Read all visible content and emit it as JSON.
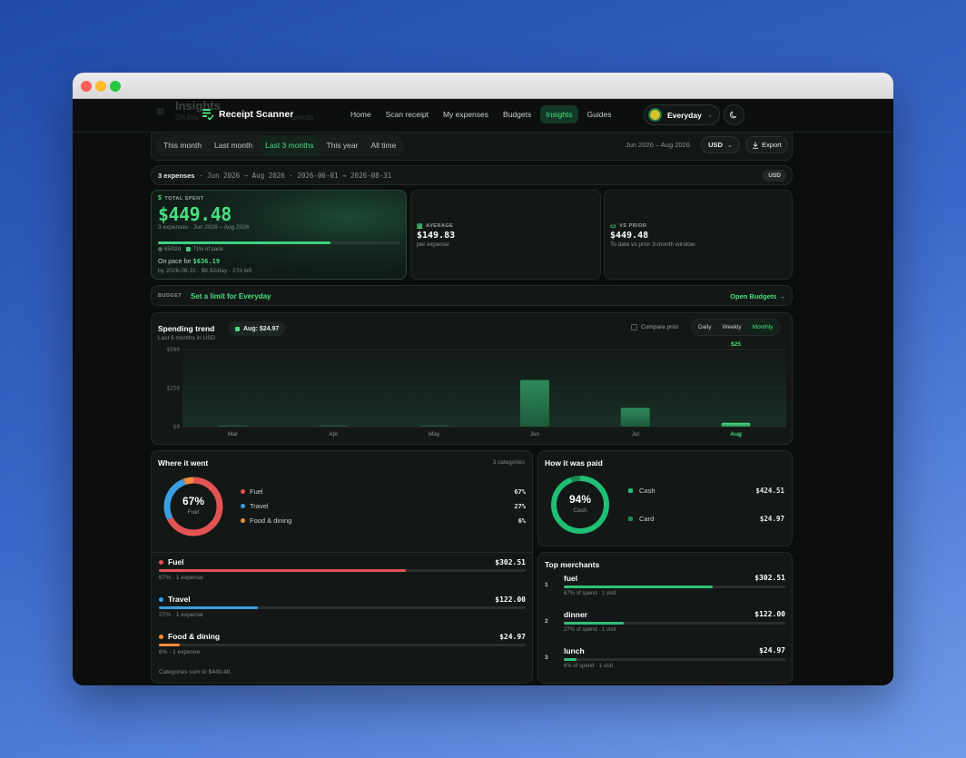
{
  "colors": {
    "accent": "#4ade80",
    "fuel": "#e25454",
    "travel": "#3b9ee0",
    "food": "#f08c3a",
    "cash": "#1fbf75",
    "card": "#178a55"
  },
  "header": {
    "ghost_title": "Insights",
    "ghost_sub_left": "On this",
    "ghost_sub_right": "spends",
    "brand": "Receipt Scanner",
    "nav": [
      "Home",
      "Scan receipt",
      "My expenses",
      "Budgets",
      "Insights",
      "Guides"
    ],
    "active_nav": "Insights",
    "workspace": "Everyday"
  },
  "range": {
    "tabs": [
      "This month",
      "Last month",
      "Last 3 months",
      "This year",
      "All time"
    ],
    "active": "Last 3 months",
    "dates": "Jun 2026 – Aug 2026",
    "currency": "USD",
    "export_label": "Export"
  },
  "summary": {
    "count": "3 expenses",
    "details": " · Jun 2026 – Aug 2026 · 2026-06-01 → 2026-08-31",
    "badge": "USD"
  },
  "total": {
    "label": "TOTAL SPENT",
    "amount": "$449.48",
    "sub": "3 expenses · Jun 2026 – Aug 2026",
    "progress_fraction": 0.71,
    "days": "65/92d",
    "pace_pct": "71% of pace",
    "onpace_label": "On pace for",
    "onpace_value": "$636.19",
    "onpace_sub": "by 2026-08-31 · $6.92/day · 27d left"
  },
  "average": {
    "label": "AVERAGE",
    "value": "$149.83",
    "sub": "per expense"
  },
  "vs_prior": {
    "label": "VS PRIOR",
    "value": "$449.48",
    "sub": "To date vs prior 3-month window"
  },
  "budget": {
    "label": "BUDGET",
    "link": "Set a limit for Everyday",
    "open": "Open Budgets →"
  },
  "trend": {
    "title": "Spending trend",
    "sub": "Last 6 months in USD",
    "pill": "Aug: $24.97",
    "compare": "Compare prior",
    "granularity": [
      "Daily",
      "Weekly",
      "Monthly"
    ],
    "active_granularity": "Monthly"
  },
  "chart_data": {
    "type": "bar",
    "categories": [
      "Mar",
      "Apr",
      "May",
      "Jun",
      "Jul",
      "Aug"
    ],
    "values": [
      0,
      0,
      0,
      302.51,
      122.0,
      24.97
    ],
    "highlight": "Aug",
    "highlight_label": "$25",
    "yticks": [
      "$500",
      "$250",
      "$0"
    ],
    "ylim": [
      0,
      500
    ]
  },
  "where": {
    "title": "Where it went",
    "meta": "3 categories",
    "center_pct": "67%",
    "center_name": "Fuel",
    "legend": [
      {
        "name": "Fuel",
        "pct": "67%",
        "share": 0.673
      },
      {
        "name": "Travel",
        "pct": "27%",
        "share": 0.271
      },
      {
        "name": "Food & dining",
        "pct": "6%",
        "share": 0.056
      }
    ],
    "categories": [
      {
        "name": "Fuel",
        "amount": "$302.51",
        "sub": "67% · 1 expense",
        "share": 0.673
      },
      {
        "name": "Travel",
        "amount": "$122.00",
        "sub": "27% · 1 expense",
        "share": 0.271
      },
      {
        "name": "Food & dining",
        "amount": "$24.97",
        "sub": "6% · 1 expense",
        "share": 0.056
      }
    ],
    "footer": "Categories sum to $449.48."
  },
  "paid": {
    "title": "How it was paid",
    "center_pct": "94%",
    "center_name": "Cash",
    "rows": [
      {
        "name": "Cash",
        "amount": "$424.51",
        "share": 0.944
      },
      {
        "name": "Card",
        "amount": "$24.97",
        "share": 0.056
      }
    ]
  },
  "merchants": {
    "title": "Top merchants",
    "rows": [
      {
        "rank": "1",
        "name": "fuel",
        "amount": "$302.51",
        "sub": "67% of spend · 1 visit",
        "share": 0.673
      },
      {
        "rank": "2",
        "name": "dinner",
        "amount": "$122.00",
        "sub": "27% of spend · 1 visit",
        "share": 0.271
      },
      {
        "rank": "3",
        "name": "lunch",
        "amount": "$24.97",
        "sub": "6% of spend · 1 visit",
        "share": 0.056
      }
    ]
  }
}
